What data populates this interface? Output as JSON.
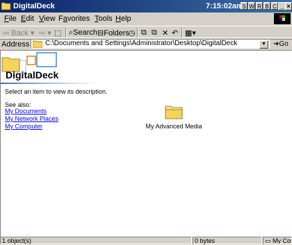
{
  "window": {
    "title": "DigitalDeck"
  },
  "tray": {
    "clock": "7:15:02am",
    "buttons": [
      "S",
      "W",
      "R",
      "B",
      "C"
    ]
  },
  "menu": {
    "items": [
      {
        "label": "File",
        "key": "F"
      },
      {
        "label": "Edit",
        "key": "E"
      },
      {
        "label": "View",
        "key": "V"
      },
      {
        "label": "Favorites",
        "key": "a"
      },
      {
        "label": "Tools",
        "key": "T"
      },
      {
        "label": "Help",
        "key": "H"
      }
    ]
  },
  "toolbar": {
    "back": "Back",
    "search": "Search",
    "folders": "Folders"
  },
  "address": {
    "label": "Address",
    "path": "C:\\Documents and Settings\\Administrator\\Desktop\\DigitalDeck",
    "go": "Go"
  },
  "sidepanel": {
    "folder_title": "DigitalDeck",
    "description": "Select an item to view its description.",
    "see_also": "See also:",
    "links": [
      "My Documents",
      "My Network Places",
      "My Computer"
    ]
  },
  "files": [
    {
      "name": "My Advanced Media",
      "icon": "folder-icon"
    }
  ],
  "statusbar": {
    "objects": "1 object(s)",
    "size": "0 bytes",
    "zone": "My Computer"
  }
}
